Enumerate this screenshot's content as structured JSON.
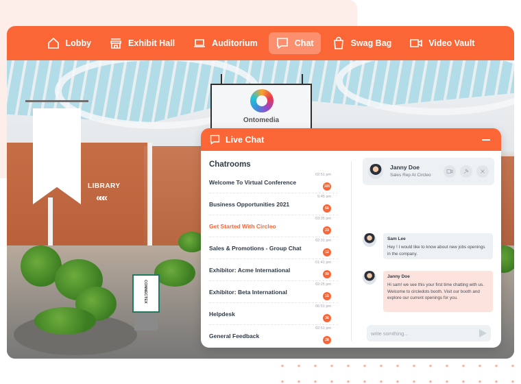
{
  "nav": {
    "items": [
      {
        "label": "Lobby",
        "icon": "home-icon",
        "active": false
      },
      {
        "label": "Exhibit Hall",
        "icon": "storefront-icon",
        "active": false
      },
      {
        "label": "Auditorium",
        "icon": "laptop-icon",
        "active": false
      },
      {
        "label": "Chat",
        "icon": "chat-bubble-icon",
        "active": true
      },
      {
        "label": "Swag Bag",
        "icon": "shopping-bag-icon",
        "active": false
      },
      {
        "label": "Video Vault",
        "icon": "video-camera-icon",
        "active": false
      }
    ]
  },
  "scene": {
    "sign_brand": "Ontomedia",
    "library_label": "LIBRARY",
    "library_arrows": "«««",
    "kiosk_brand": "CONNECTEX"
  },
  "colors": {
    "accent": "#fb6637",
    "incoming_bubble": "#eef1f4",
    "outgoing_bubble": "#fde3de"
  },
  "chat": {
    "title": "Live Chat",
    "rooms_title": "Chatrooms",
    "rooms": [
      {
        "name": "Welcome To Virtual Conference",
        "time": "02:51 pm",
        "unread": "105",
        "active": false
      },
      {
        "name": "Business Opportunities 2021",
        "time": "5:45 am",
        "unread": "66",
        "active": false
      },
      {
        "name": "Get Started With Circleo",
        "time": "03:35 pm",
        "unread": "23",
        "active": true
      },
      {
        "name": "Sales & Promotions - Group Chat",
        "time": "02:31 pm",
        "unread": "12",
        "active": false
      },
      {
        "name": "Exhibitor: Acme International",
        "time": "01:41 pm",
        "unread": "09",
        "active": false
      },
      {
        "name": "Exhibitor: Beta International",
        "time": "02:25 pm",
        "unread": "15",
        "active": false
      },
      {
        "name": "Helpdesk",
        "time": "06:51 pm",
        "unread": "36",
        "active": false
      },
      {
        "name": "General Feedback",
        "time": "02:51 pm",
        "unread": "28",
        "active": false
      }
    ],
    "contact": {
      "name": "Janny Doe",
      "role": "Sales Rep At Circleo"
    },
    "messages": [
      {
        "sender": "Sam Lee",
        "text": "Hey ! I would like to  know about new jobs openings in the company."
      },
      {
        "sender": "Janny Doe",
        "text": "Hi sam! we see this your first time chatting with us. Welcome to circledots booth. Visit our booth and explore our current openings for you."
      }
    ],
    "input": {
      "value": "",
      "placeholder": "write somthing..."
    }
  }
}
